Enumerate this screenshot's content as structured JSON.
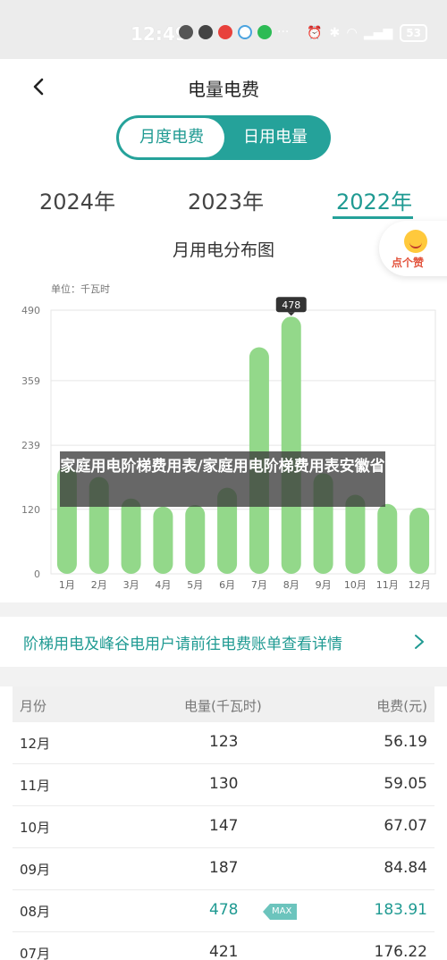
{
  "status_bar": {
    "time": "12:49",
    "more": "···",
    "battery": "53"
  },
  "header": {
    "title": "电量电费"
  },
  "segment": {
    "active_label": "月度电费",
    "inactive_label": "日用电量"
  },
  "years": [
    "2024年",
    "2023年",
    "2022年"
  ],
  "selected_year": "2022年",
  "promo": {
    "label": "点个赞"
  },
  "overlay_text": "家庭用电阶梯费用表/家庭用电阶梯费用表安徽省",
  "chart_data": {
    "type": "bar",
    "title": "月用电分布图",
    "unit_label": "单位：千瓦时",
    "categories": [
      "1月",
      "2月",
      "3月",
      "4月",
      "5月",
      "6月",
      "7月",
      "8月",
      "9月",
      "10月",
      "11月",
      "12月"
    ],
    "values": [
      200,
      180,
      140,
      125,
      128,
      160,
      421,
      478,
      187,
      147,
      130,
      123
    ],
    "yticks": [
      "490",
      "359",
      "239",
      "120",
      "0"
    ],
    "ylim": [
      0,
      490
    ],
    "highlight": {
      "index": 7,
      "label": "478"
    },
    "grid": true,
    "bar_color": "#93d88a"
  },
  "link": {
    "text": "阶梯用电及峰谷电用户请前往电费账单查看详情"
  },
  "table": {
    "headers": {
      "month": "月份",
      "kwh": "电量(千瓦时)",
      "fee": "电费(元)"
    },
    "max_badge": "MAX",
    "rows": [
      {
        "month": "12月",
        "kwh": "123",
        "fee": "56.19"
      },
      {
        "month": "11月",
        "kwh": "130",
        "fee": "59.05"
      },
      {
        "month": "10月",
        "kwh": "147",
        "fee": "67.07"
      },
      {
        "month": "09月",
        "kwh": "187",
        "fee": "84.84"
      },
      {
        "month": "08月",
        "kwh": "478",
        "fee": "183.91"
      },
      {
        "month": "07月",
        "kwh": "421",
        "fee": "176.22"
      }
    ]
  },
  "colors": {
    "accent": "#25a29a",
    "bar": "#93d88a"
  }
}
